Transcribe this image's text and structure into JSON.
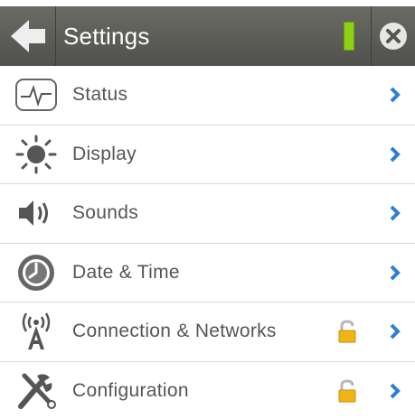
{
  "header": {
    "title": "Settings",
    "battery_color": "#8fd018",
    "back_icon": "arrow-left-icon",
    "close_icon": "close-icon"
  },
  "menu": {
    "accent_color": "#2a7fd4",
    "items": [
      {
        "label": "Status",
        "icon": "pulse-icon",
        "locked": false
      },
      {
        "label": "Display",
        "icon": "brightness-icon",
        "locked": false
      },
      {
        "label": "Sounds",
        "icon": "speaker-icon",
        "locked": false
      },
      {
        "label": "Date & Time",
        "icon": "clock-icon",
        "locked": false
      },
      {
        "label": "Connection & Networks",
        "icon": "antenna-icon",
        "locked": true
      },
      {
        "label": "Configuration",
        "icon": "tools-icon",
        "locked": true
      }
    ]
  }
}
